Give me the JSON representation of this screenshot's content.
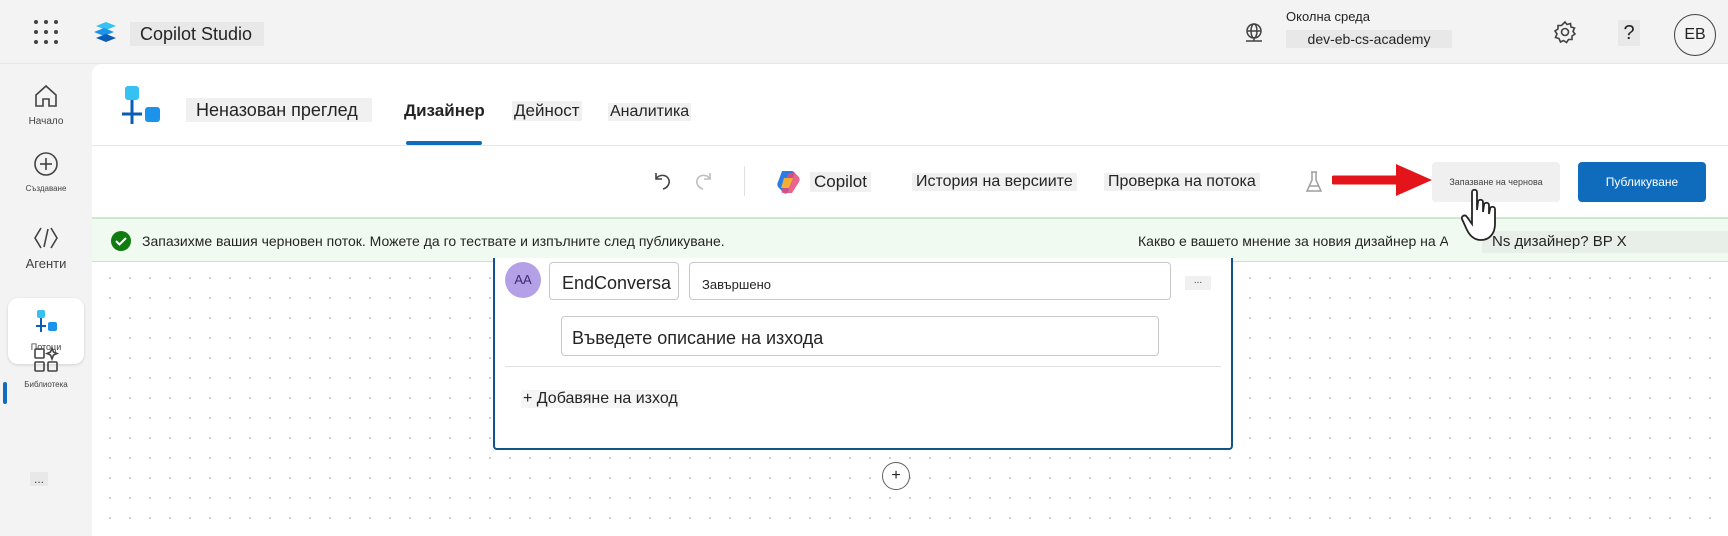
{
  "topbar": {
    "app_name": "Copilot Studio",
    "env_label": "Околна среда",
    "env_value": "dev-eb-cs-academy",
    "help_glyph": "?",
    "avatar_initials": "EB"
  },
  "rail": {
    "items": [
      {
        "label": "Начало",
        "icon": "home-icon"
      },
      {
        "label": "Създаване",
        "icon": "plus-circle-icon"
      },
      {
        "label": "Агенти",
        "icon": "agents-icon"
      },
      {
        "label": "Потоци",
        "icon": "flows-icon"
      },
      {
        "label": "Библиотека",
        "icon": "library-icon"
      }
    ],
    "more_label": "..."
  },
  "flow": {
    "name": "Неназован преглед",
    "tabs": {
      "designer": "Дизайнер",
      "activity": "Дейност",
      "analytics": "Аналитика"
    }
  },
  "toolbar": {
    "copilot_label": "Copilot",
    "history_label": "История на версиите",
    "checker_label": "Проверка на потока",
    "save_draft_label": "Запазване на чернова",
    "publish_label": "Публикуване"
  },
  "banner": {
    "message": "Запазихме вашия черновен поток. Можете да го тествате и изпълните след публикуване.",
    "feedback_question": "Какво е вашето мнение за новия дизайнер на Agents?",
    "feedback_link": "Ns дизайнер? BP X"
  },
  "node": {
    "avatar_initials": "AA",
    "var_name": "EndConversa",
    "var_value": "Завършено",
    "more_label": "...",
    "description_placeholder": "Въведете описание на изхода",
    "add_output_label": "+ Добавяне на изход"
  },
  "canvas": {
    "add_node_label": "+"
  },
  "colors": {
    "accent": "#0f6cbd",
    "success": "#107c10",
    "annotation_arrow": "#e3151a"
  }
}
